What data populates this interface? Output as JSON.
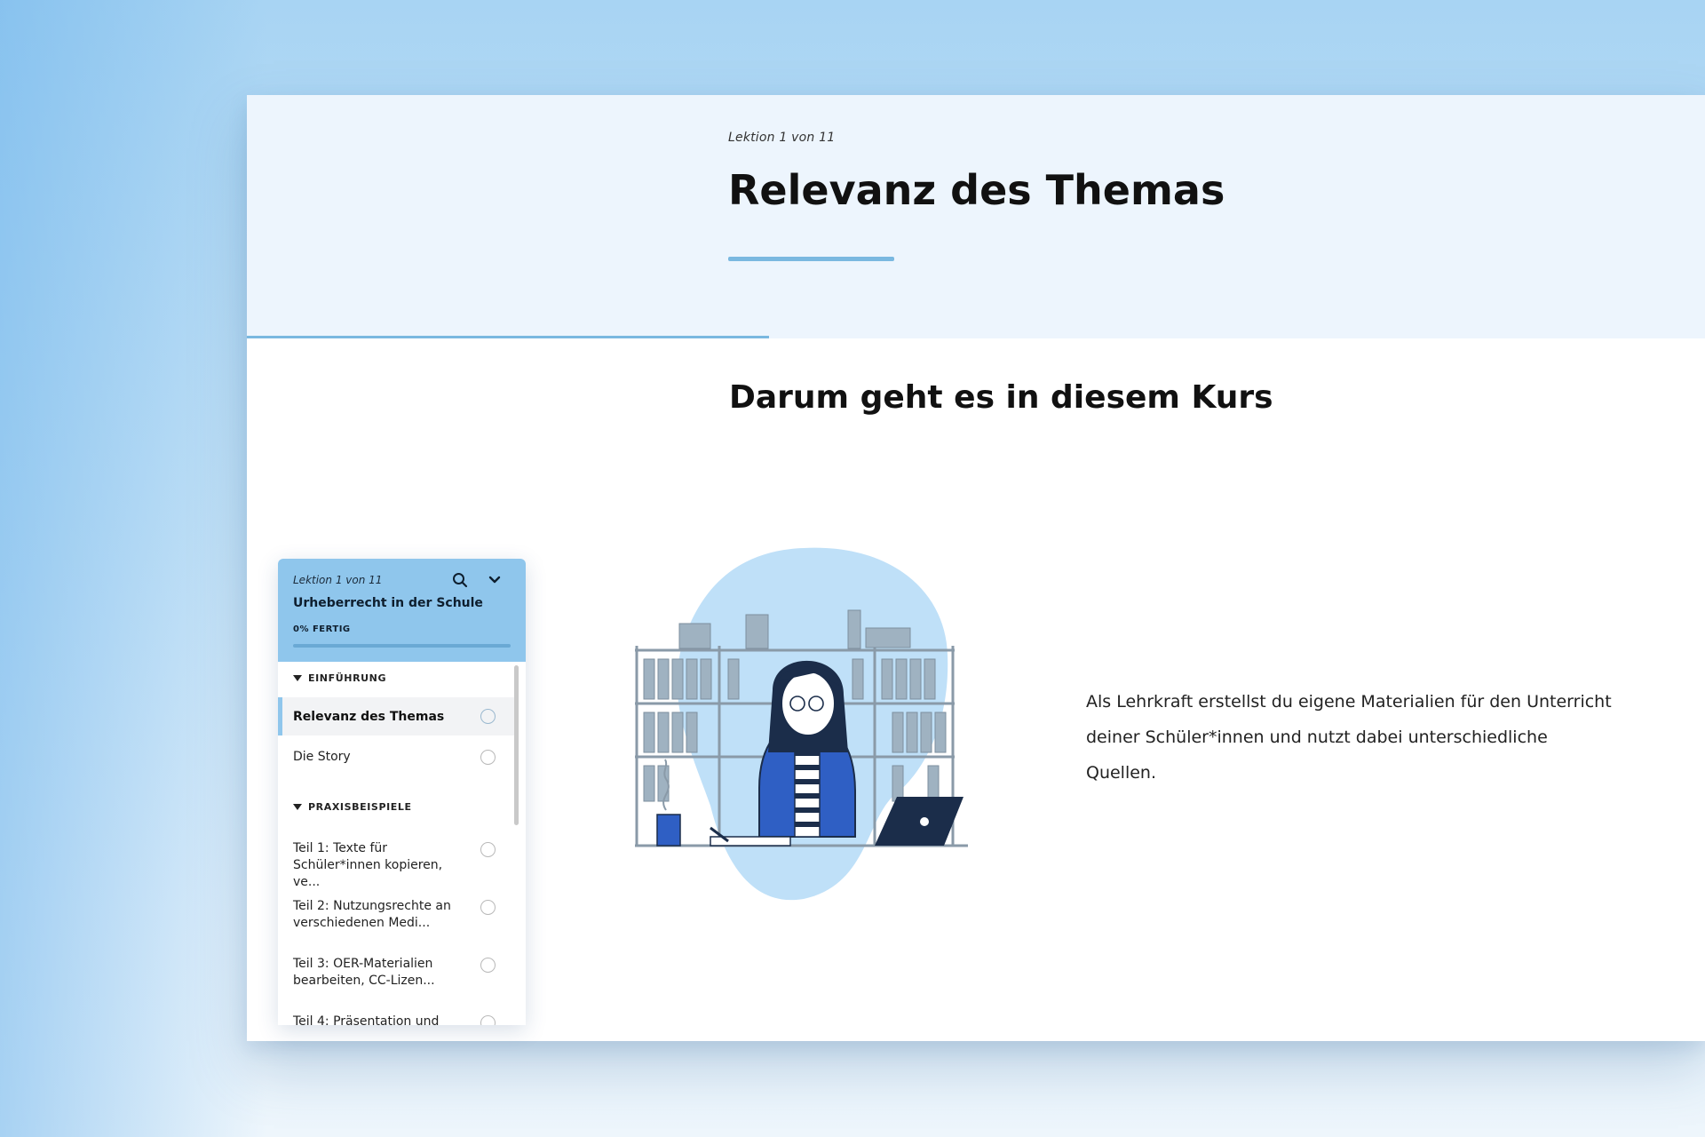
{
  "lesson": {
    "counter": "Lektion 1 von 11",
    "title": "Relevanz des Themas",
    "progress_fraction": 0.358
  },
  "content": {
    "section_title": "Darum geht es in diesem Kurs",
    "paragraph": "Als Lehrkraft erstellst du eigene Materialien für den Unterricht deiner Schüler*innen und nutzt dabei unterschiedliche Quellen."
  },
  "sidebar": {
    "counter": "Lektion 1 von 11",
    "course_title": "Urheberrecht in der Schule",
    "progress_label": "0% FERTIG",
    "progress_fraction": 0,
    "sections": [
      {
        "label": "EINFÜHRUNG",
        "items": [
          {
            "label": "Relevanz des Themas",
            "active": true
          },
          {
            "label": "Die Story",
            "active": false
          }
        ]
      },
      {
        "label": "PRAXISBEISPIELE",
        "items": [
          {
            "label": "Teil 1: Texte für Schüler*innen kopieren, ve...",
            "active": false
          },
          {
            "label": "Teil 2: Nutzungsrechte an verschiedenen Medi...",
            "active": false
          },
          {
            "label": "Teil 3: OER-Materialien bearbeiten, CC-Lizen...",
            "active": false
          },
          {
            "label": "Teil 4: Präsentation und",
            "active": false
          }
        ]
      }
    ]
  },
  "icons": {
    "search": "search-icon",
    "collapse": "chevron-down-icon",
    "status": "circle-outline-icon",
    "section_toggle": "triangle-down-icon"
  },
  "colors": {
    "accent": "#7ab8e0",
    "sidebar_header": "#8fc6ec",
    "hero_bg": "#edf5fd"
  }
}
